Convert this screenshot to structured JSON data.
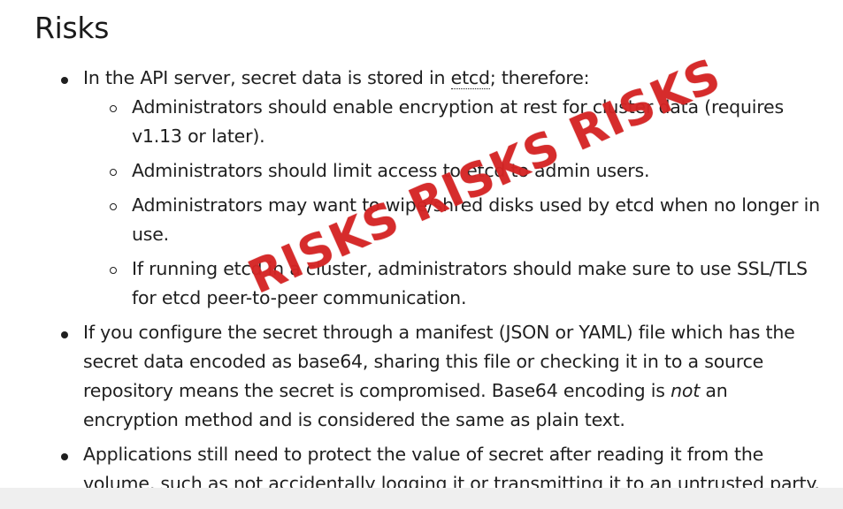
{
  "title": "Risks",
  "stamp_text": "RISKS RISKS RISKS",
  "items": [
    {
      "text_before_abbr": "In the API server, secret data is stored in ",
      "abbr": "etcd",
      "text_after_abbr": "; therefore:",
      "subitems": [
        "Administrators should enable encryption at rest for cluster data (requires v1.13 or later).",
        "Administrators should limit access to etcd to admin users.",
        "Administrators may want to wipe/shred disks used by etcd when no longer in use.",
        "If running etcd in a cluster, administrators should make sure to use SSL/TLS for etcd peer-to-peer communication."
      ]
    },
    {
      "text_before_em": "If you configure the secret through a manifest (JSON or YAML) file which has the secret data encoded as base64, sharing this file or checking it in to a source repository means the secret is compromised. Base64 encoding is ",
      "em": "not",
      "text_after_em": " an encryption method and is considered the same as plain text."
    },
    {
      "text": "Applications still need to protect the value of secret after reading it from the volume, such as not accidentally logging it or transmitting it to an untrusted party."
    }
  ]
}
